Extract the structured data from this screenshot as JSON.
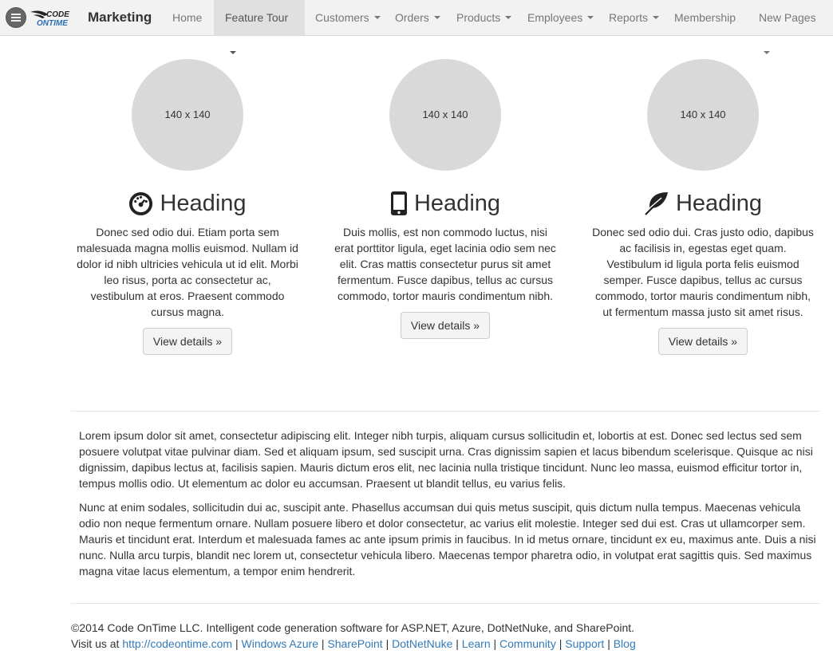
{
  "navbar": {
    "brand": "Marketing",
    "logo_text_top": "CODE",
    "logo_text_bottom": "ONTIME",
    "items": [
      {
        "label": "Home",
        "dropdown": false
      },
      {
        "label": "Feature Tour",
        "dropdown": true,
        "active": true
      },
      {
        "label": "Customers",
        "dropdown": true
      },
      {
        "label": "Orders",
        "dropdown": true
      },
      {
        "label": "Products",
        "dropdown": true
      },
      {
        "label": "Employees",
        "dropdown": true
      },
      {
        "label": "Reports",
        "dropdown": true
      },
      {
        "label": "Membership",
        "dropdown": false
      },
      {
        "label": "New Pages",
        "dropdown": true
      }
    ]
  },
  "features": [
    {
      "image_label": "140 x 140",
      "icon": "dashboard-icon",
      "heading": "Heading",
      "text": "Donec sed odio dui. Etiam porta sem malesuada magna mollis euismod. Nullam id dolor id nibh ultricies vehicula ut id elit. Morbi leo risus, porta ac consectetur ac, vestibulum at eros. Praesent commodo cursus magna.",
      "button": "View details »"
    },
    {
      "image_label": "140 x 140",
      "icon": "phone-icon",
      "heading": "Heading",
      "text": "Duis mollis, est non commodo luctus, nisi erat porttitor ligula, eget lacinia odio sem nec elit. Cras mattis consectetur purus sit amet fermentum. Fusce dapibus, tellus ac cursus commodo, tortor mauris condimentum nibh.",
      "button": "View details »"
    },
    {
      "image_label": "140 x 140",
      "icon": "leaf-icon",
      "heading": "Heading",
      "text": "Donec sed odio dui. Cras justo odio, dapibus ac facilisis in, egestas eget quam. Vestibulum id ligula porta felis euismod semper. Fusce dapibus, tellus ac cursus commodo, tortor mauris condimentum nibh, ut fermentum massa justo sit amet risus.",
      "button": "View details »"
    }
  ],
  "content": {
    "paragraph1": "Lorem ipsum dolor sit amet, consectetur adipiscing elit. Integer nibh turpis, aliquam cursus sollicitudin et, lobortis at est. Donec sed lectus sed sem posuere volutpat vitae pulvinar diam. Sed et aliquam ipsum, sed suscipit urna. Cras dignissim sapien et lacus bibendum scelerisque. Quisque ac nisi dignissim, dapibus lectus at, facilisis sapien. Mauris dictum eros elit, nec lacinia nulla tristique tincidunt. Nunc leo massa, euismod efficitur tortor in, tempus mollis odio. Ut elementum ac dolor eu accumsan. Praesent ut blandit tellus, eu varius felis.",
    "paragraph2": "Nunc at enim sodales, sollicitudin dui ac, suscipit ante. Phasellus accumsan dui quis metus suscipit, quis dictum nulla tempus. Maecenas vehicula odio non neque fermentum ornare. Nullam posuere libero et dolor consectetur, ac varius elit molestie. Integer sed dui est. Cras ut ullamcorper sem. Mauris et tincidunt erat. Interdum et malesuada fames ac ante ipsum primis in faucibus. In id metus ornare, tincidunt ex eu, maximus ante. Duis a nisi nunc. Nulla arcu turpis, blandit nec lorem ut, consectetur vehicula libero. Maecenas tempor pharetra odio, in volutpat erat sagittis quis. Sed maximus magna vitae lacus elementum, a tempor enim hendrerit."
  },
  "footer": {
    "copyright": "©2014 Code OnTime LLC. Intelligent code generation software for ASP.NET, Azure, DotNetNuke, and SharePoint.",
    "visit_prefix": "Visit us at",
    "separator": "|",
    "links": [
      "http://codeontime.com",
      "Windows Azure",
      "SharePoint",
      "DotNetNuke",
      "Learn",
      "Community",
      "Support",
      "Blog"
    ]
  },
  "colors": {
    "link": "#337ab7",
    "navbar_bg": "#f2f2f2",
    "placeholder": "#d9d9d9"
  }
}
